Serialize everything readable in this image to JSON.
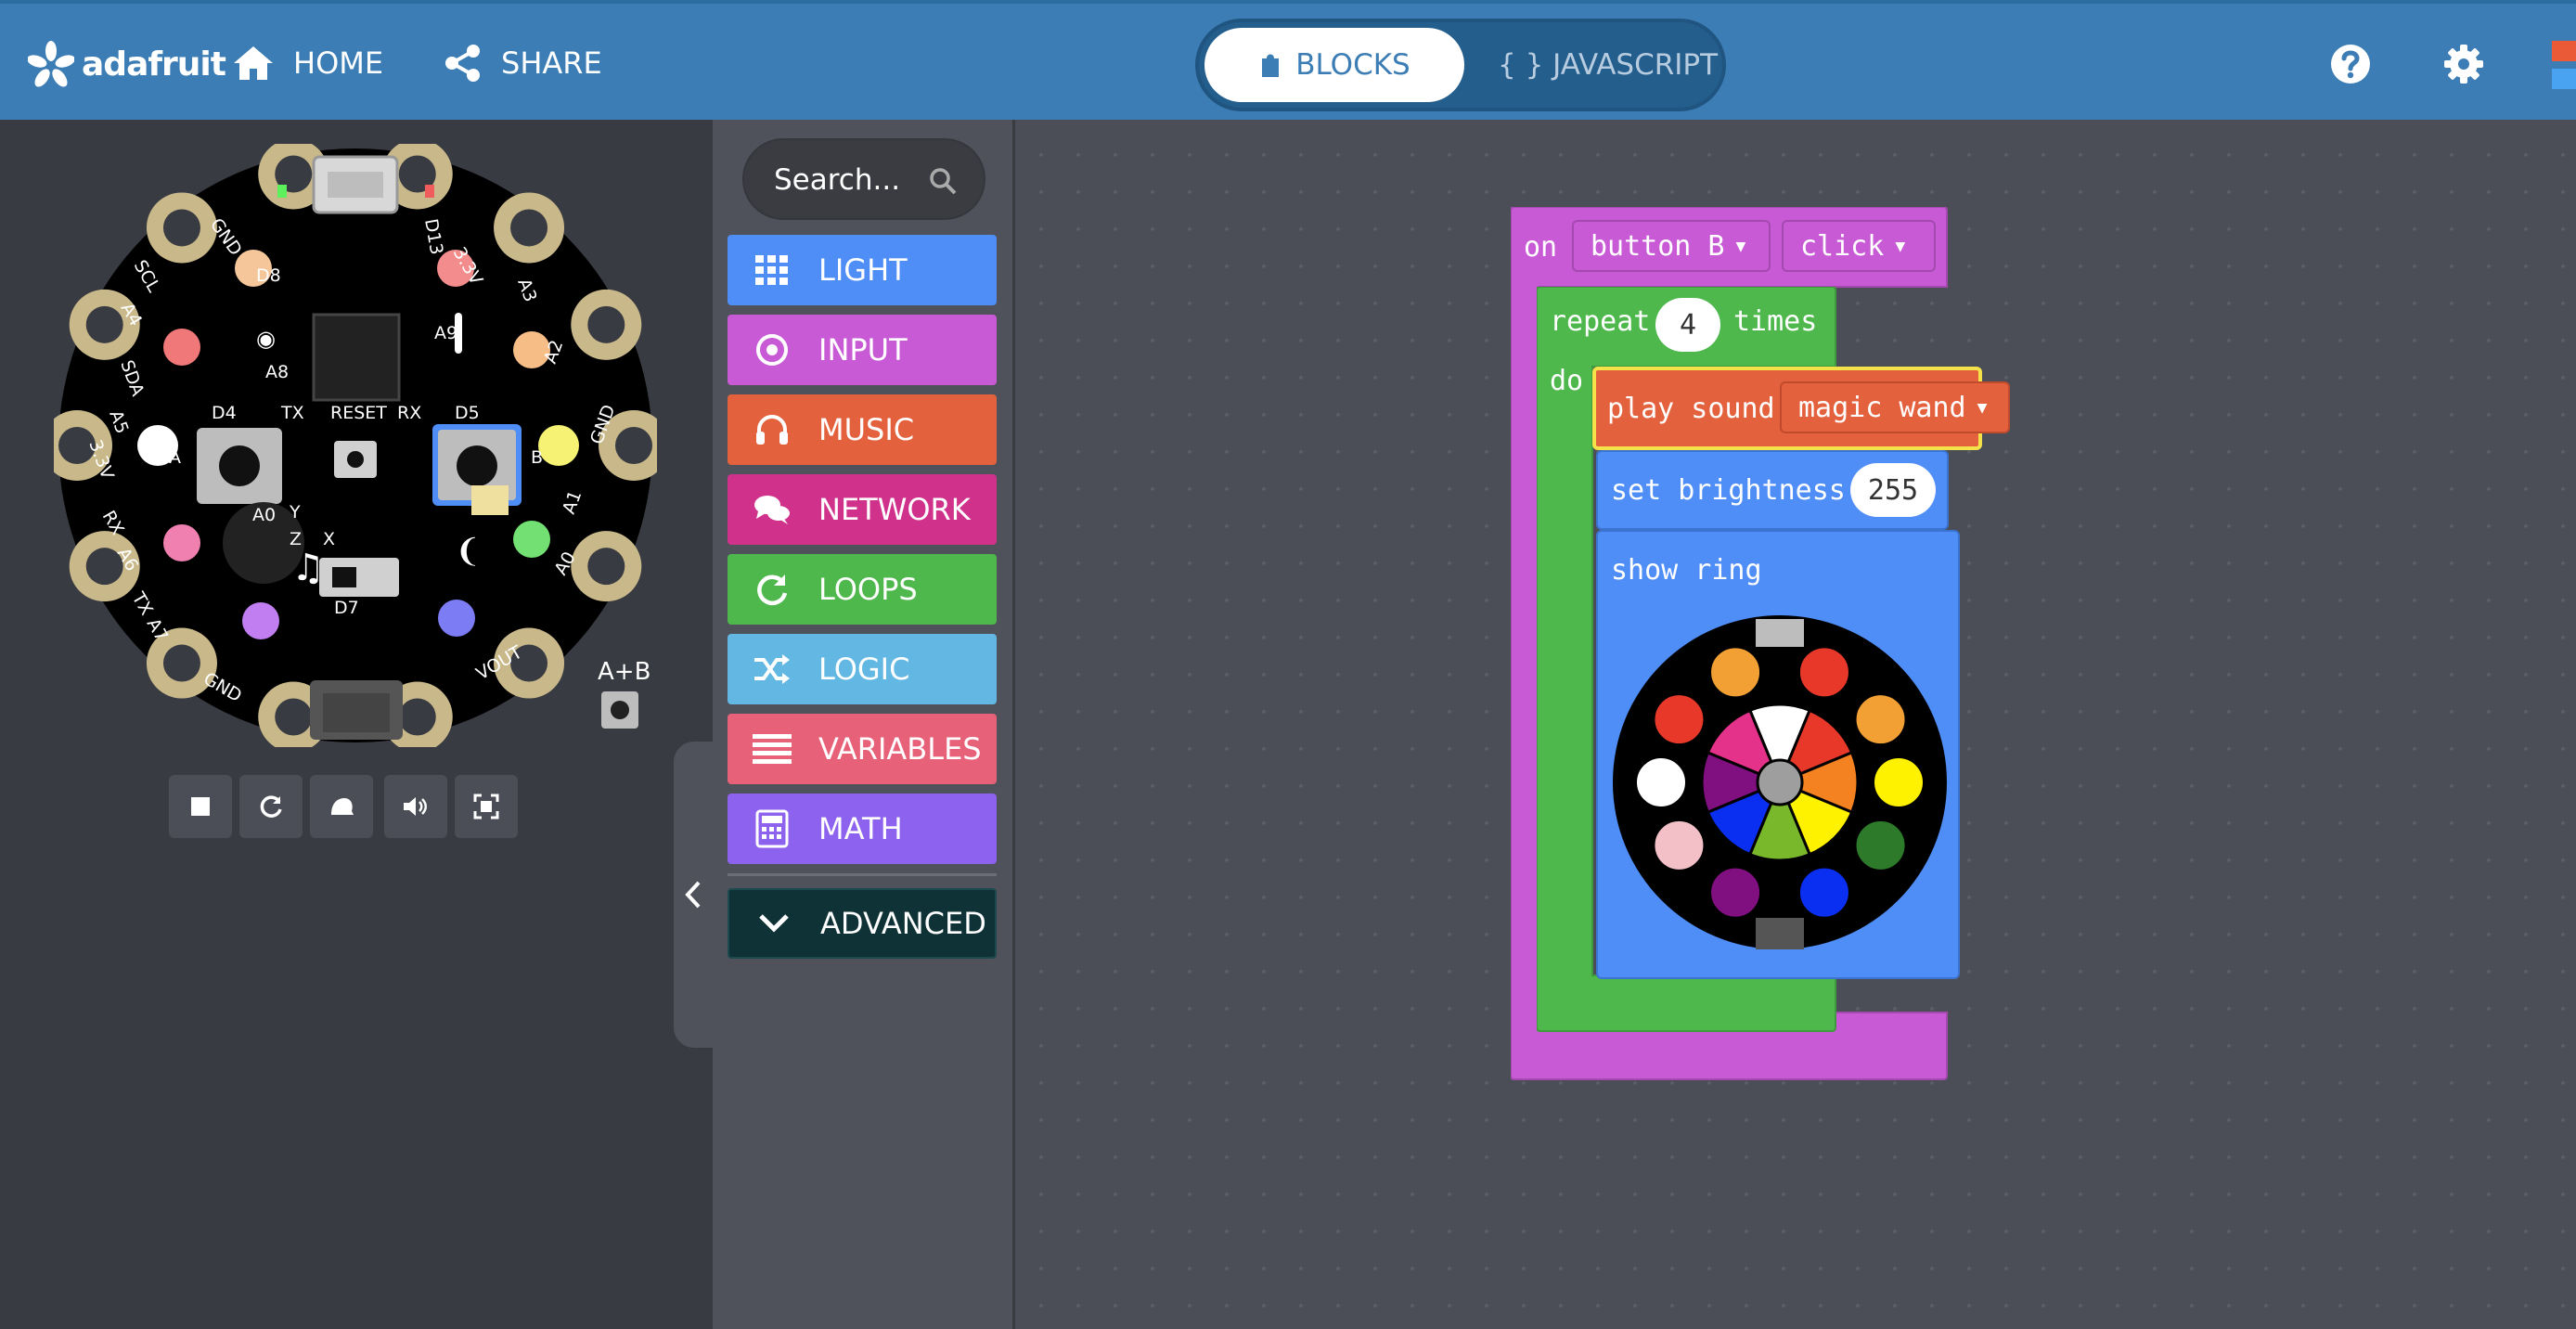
{
  "topbar": {
    "brand": "adafruit",
    "home_label": "HOME",
    "share_label": "SHARE",
    "blocks_label": "BLOCKS",
    "javascript_label": "{ } JAVASCRIPT"
  },
  "simulator": {
    "pin_labels": [
      "GND",
      "D8",
      "D13",
      "3.3V",
      "SCL",
      "A3",
      "A4",
      "A9",
      "SDA",
      "A8",
      "A2",
      "A5",
      "D4",
      "TX",
      "RESET",
      "RX",
      "D5",
      "3.3V",
      "GND",
      "RX",
      "A1",
      "A6",
      "A0",
      "TX",
      "A7",
      "D7",
      "A0",
      "GND",
      "VOUT",
      "Y",
      "Z",
      "X",
      "A",
      "B"
    ],
    "ab_label": "A+B"
  },
  "toolbox": {
    "search_placeholder": "Search...",
    "categories": [
      {
        "label": "LIGHT",
        "color": "#4f8ef7"
      },
      {
        "label": "INPUT",
        "color": "#c85ad6"
      },
      {
        "label": "MUSIC",
        "color": "#e4613e"
      },
      {
        "label": "NETWORK",
        "color": "#d0318a"
      },
      {
        "label": "LOOPS",
        "color": "#4fb84d"
      },
      {
        "label": "LOGIC",
        "color": "#62b8e2"
      },
      {
        "label": "VARIABLES",
        "color": "#e76179"
      },
      {
        "label": "MATH",
        "color": "#8c62ee"
      }
    ],
    "advanced_label": "ADVANCED"
  },
  "blocks": {
    "on_label": "on",
    "button_value": "button B",
    "event_value": "click",
    "repeat_label": "repeat",
    "repeat_count": "4",
    "times_label": "times",
    "do_label": "do",
    "play_sound_label": "play sound",
    "sound_value": "magic wand",
    "set_brightness_label": "set brightness",
    "brightness_value": "255",
    "show_ring_label": "show ring",
    "ring_colors": [
      "#f2a033",
      "#e8382a",
      "#f2a033",
      "#fff200",
      "#2d7a2a",
      "#0b2ff0",
      "#800f80",
      "#f4c0c8",
      "#ffffff",
      "#e8382a"
    ]
  },
  "colors": {
    "topbar": "#3b7db4",
    "event_block": "#c85ad6",
    "loop_block": "#4fb84d",
    "music_block": "#e4613e",
    "light_block": "#4f8ef7",
    "highlight": "#f5e14a"
  }
}
